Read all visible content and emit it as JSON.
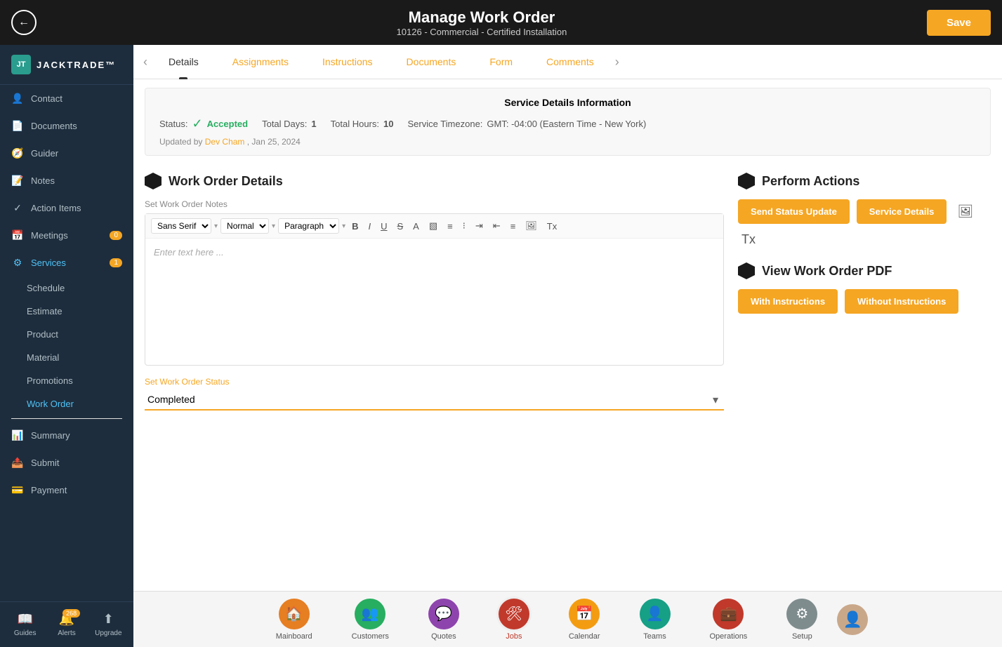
{
  "header": {
    "title": "Manage Work Order",
    "subtitle": "10126 - Commercial - Certified Installation",
    "save_label": "Save",
    "back_label": "‹"
  },
  "tabs": [
    {
      "label": "Details",
      "active": true
    },
    {
      "label": "Assignments",
      "active": false
    },
    {
      "label": "Instructions",
      "active": false
    },
    {
      "label": "Documents",
      "active": false
    },
    {
      "label": "Form",
      "active": false
    },
    {
      "label": "Comments",
      "active": false
    }
  ],
  "service_info": {
    "title": "Service Details Information",
    "status_label": "Status:",
    "status_value": "Accepted",
    "total_days_label": "Total Days:",
    "total_days_value": "1",
    "total_hours_label": "Total Hours:",
    "total_hours_value": "10",
    "timezone_label": "Service Timezone:",
    "timezone_value": "GMT: -04:00 (Eastern Time - New York)",
    "updated_by_prefix": "Updated by",
    "updated_by_name": "Dev Cham",
    "updated_date": ", Jan 25, 2024"
  },
  "work_order": {
    "section_title": "Work Order Details",
    "notes_label": "Set Work Order Notes",
    "editor_placeholder": "Enter text here ...",
    "font_family": "Sans Serif",
    "font_style": "Normal",
    "paragraph": "Paragraph",
    "status_label": "Set Work Order Status",
    "status_value": "Completed"
  },
  "perform_actions": {
    "section_title": "Perform Actions",
    "send_status_btn": "Send Status Update",
    "service_details_btn": "Service Details"
  },
  "pdf_section": {
    "section_title": "View Work Order PDF",
    "with_instructions_btn": "With Instructions",
    "without_instructions_btn": "Without Instructions"
  },
  "sidebar": {
    "logo_text": "JACKTRADE™",
    "items": [
      {
        "label": "Contact",
        "icon": "👤",
        "active": false
      },
      {
        "label": "Documents",
        "icon": "📄",
        "active": false
      },
      {
        "label": "Guider",
        "icon": "🧭",
        "active": false
      },
      {
        "label": "Notes",
        "icon": "📝",
        "active": false
      },
      {
        "label": "Action Items",
        "icon": "✓",
        "active": false
      },
      {
        "label": "Meetings",
        "icon": "📅",
        "active": false,
        "badge": "0"
      },
      {
        "label": "Services",
        "icon": "⚙",
        "active": true,
        "badge": "1"
      }
    ],
    "submenu": [
      {
        "label": "Schedule",
        "active": false
      },
      {
        "label": "Estimate",
        "active": false
      },
      {
        "label": "Product",
        "active": false
      },
      {
        "label": "Material",
        "active": false
      },
      {
        "label": "Promotions",
        "active": false
      },
      {
        "label": "Work Order",
        "active": true
      }
    ],
    "bottom_items": [
      {
        "label": "Summary",
        "icon": "📊",
        "active": false
      },
      {
        "label": "Submit",
        "icon": "📤",
        "active": false
      },
      {
        "label": "Payment",
        "icon": "💳",
        "active": false
      }
    ],
    "nav_icons": [
      {
        "label": "Guides",
        "icon": "📖"
      },
      {
        "label": "Alerts",
        "icon": "🔔",
        "badge": "268"
      },
      {
        "label": "Upgrade",
        "icon": "⬆"
      }
    ]
  },
  "bottom_nav": [
    {
      "label": "Mainboard",
      "icon": "🏠",
      "color": "ic-mainboard"
    },
    {
      "label": "Customers",
      "icon": "👥",
      "color": "ic-customers"
    },
    {
      "label": "Quotes",
      "icon": "💬",
      "color": "ic-quotes"
    },
    {
      "label": "Jobs",
      "icon": "🛠",
      "color": "ic-jobs",
      "active": true
    },
    {
      "label": "Calendar",
      "icon": "📅",
      "color": "ic-calendar"
    },
    {
      "label": "Teams",
      "icon": "👤",
      "color": "ic-teams"
    },
    {
      "label": "Operations",
      "icon": "💼",
      "color": "ic-operations"
    },
    {
      "label": "Setup",
      "icon": "⚙",
      "color": "ic-setup"
    }
  ]
}
